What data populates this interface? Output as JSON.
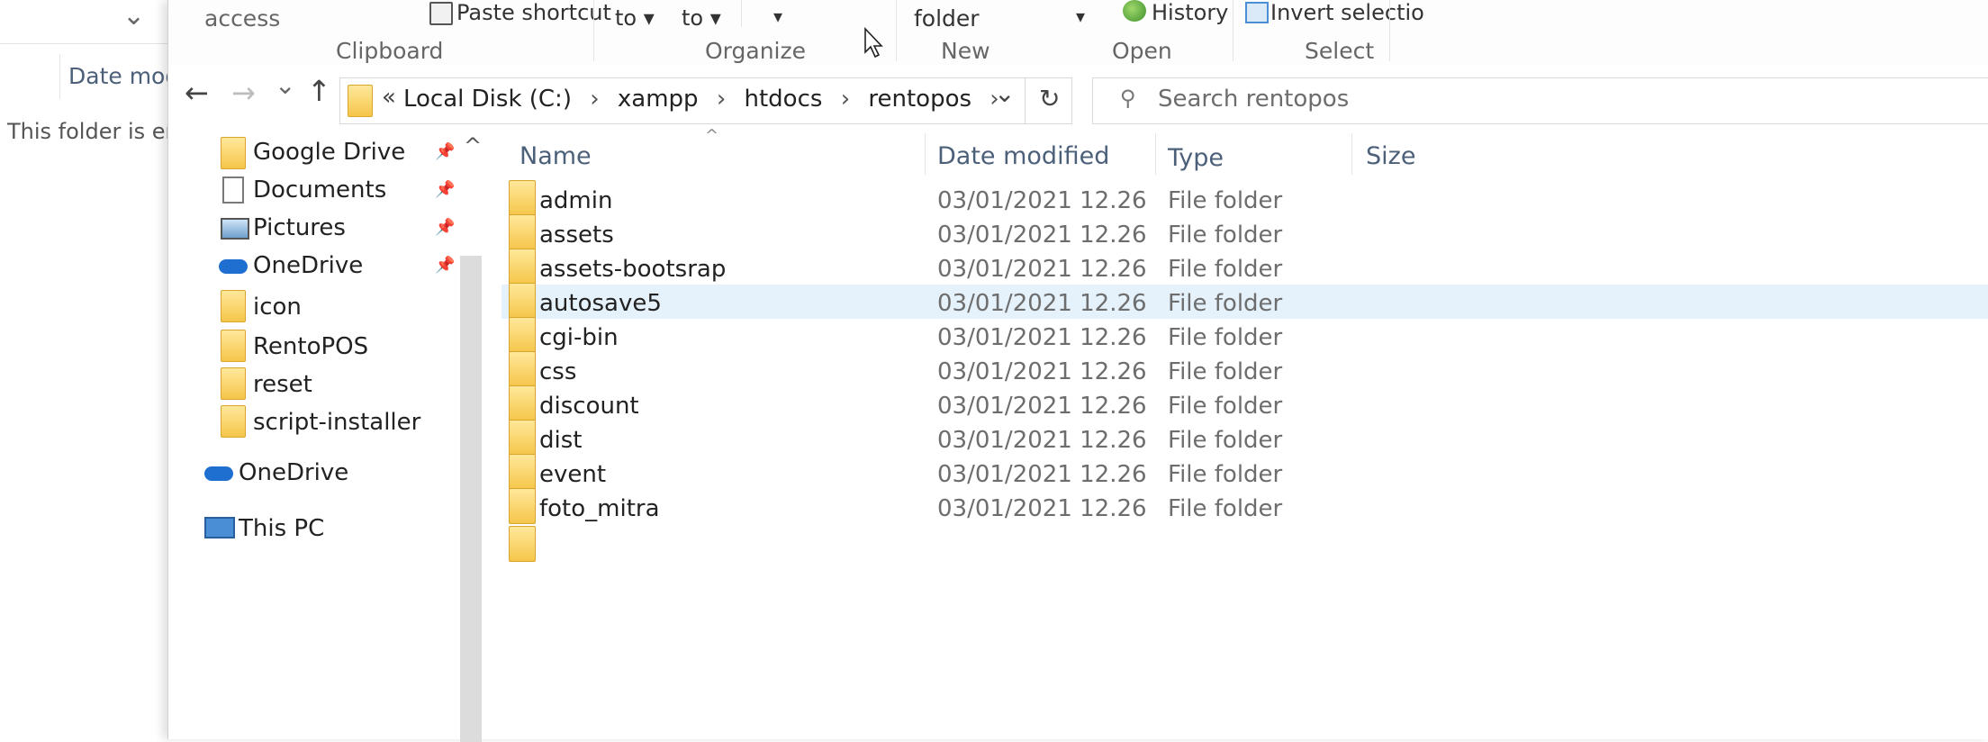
{
  "background_window": {
    "chevron": "⌄",
    "column_header": "Date modifi",
    "empty_text": "This folder is empty"
  },
  "ribbon": {
    "access_text": "access",
    "paste_shortcut": "Paste shortcut",
    "move_to": "to ▾",
    "copy_to": "to ▾",
    "delete_arrow": "▾",
    "new_folder": "folder",
    "properties_arrow": "▾",
    "history": "History",
    "invert_selection": "Invert selectio",
    "groups": {
      "clipboard": "Clipboard",
      "organize": "Organize",
      "new": "New",
      "open": "Open",
      "select": "Select"
    }
  },
  "addressbar": {
    "back": "←",
    "forward": "→",
    "recent": "⌄",
    "up": "↑",
    "overflow": "«",
    "crumbs": [
      "Local Disk (C:)",
      "xampp",
      "htdocs",
      "rentopos"
    ],
    "separator": "›",
    "dropdown": "⌄",
    "refresh": "↻",
    "search_placeholder": "Search rentopos"
  },
  "nav": {
    "items": [
      {
        "label": "Google Drive",
        "icon": "folder-icon",
        "pinned": true
      },
      {
        "label": "Documents",
        "icon": "documents-icon",
        "pinned": true
      },
      {
        "label": "Pictures",
        "icon": "pictures-icon",
        "pinned": true
      },
      {
        "label": "OneDrive",
        "icon": "onedrive-icon",
        "pinned": true
      },
      {
        "label": "icon",
        "icon": "folder-icon",
        "pinned": false
      },
      {
        "label": "RentoPOS",
        "icon": "folder-icon",
        "pinned": false
      },
      {
        "label": "reset",
        "icon": "folder-icon",
        "pinned": false
      },
      {
        "label": "script-installer",
        "icon": "folder-icon",
        "pinned": false
      },
      {
        "label": "OneDrive",
        "icon": "onedrive-icon",
        "pinned": false
      },
      {
        "label": "This PC",
        "icon": "pc-icon",
        "pinned": false
      }
    ],
    "scroll_up": "^"
  },
  "filelist": {
    "sort_indicator": "^",
    "columns": {
      "name": "Name",
      "date": "Date modified",
      "type": "Type",
      "size": "Size"
    },
    "rows": [
      {
        "name": "admin",
        "date": "03/01/2021 12.26",
        "type": "File folder"
      },
      {
        "name": "assets",
        "date": "03/01/2021 12.26",
        "type": "File folder"
      },
      {
        "name": "assets-bootsrap",
        "date": "03/01/2021 12.26",
        "type": "File folder"
      },
      {
        "name": "autosave5",
        "date": "03/01/2021 12.26",
        "type": "File folder"
      },
      {
        "name": "cgi-bin",
        "date": "03/01/2021 12.26",
        "type": "File folder"
      },
      {
        "name": "css",
        "date": "03/01/2021 12.26",
        "type": "File folder"
      },
      {
        "name": "discount",
        "date": "03/01/2021 12.26",
        "type": "File folder"
      },
      {
        "name": "dist",
        "date": "03/01/2021 12.26",
        "type": "File folder"
      },
      {
        "name": "event",
        "date": "03/01/2021 12.26",
        "type": "File folder"
      },
      {
        "name": "foto_mitra",
        "date": "03/01/2021 12.26",
        "type": "File folder"
      }
    ]
  }
}
